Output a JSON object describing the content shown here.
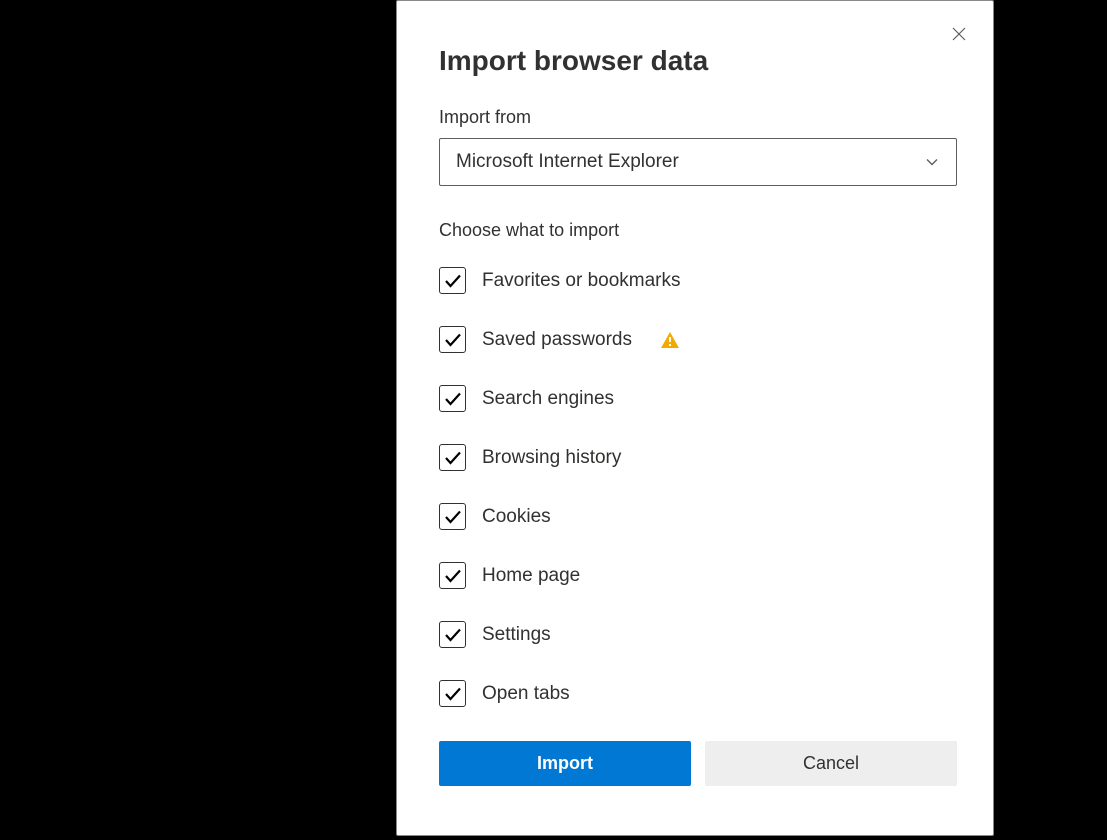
{
  "title": "Import browser data",
  "import_from_label": "Import from",
  "import_from_value": "Microsoft Internet Explorer",
  "choose_label": "Choose what to import",
  "items": [
    {
      "label": "Favorites or bookmarks",
      "checked": true,
      "warn": false
    },
    {
      "label": "Saved passwords",
      "checked": true,
      "warn": true
    },
    {
      "label": "Search engines",
      "checked": true,
      "warn": false
    },
    {
      "label": "Browsing history",
      "checked": true,
      "warn": false
    },
    {
      "label": "Cookies",
      "checked": true,
      "warn": false
    },
    {
      "label": "Home page",
      "checked": true,
      "warn": false
    },
    {
      "label": "Settings",
      "checked": true,
      "warn": false
    },
    {
      "label": "Open tabs",
      "checked": true,
      "warn": false
    }
  ],
  "primary_button": "Import",
  "secondary_button": "Cancel"
}
